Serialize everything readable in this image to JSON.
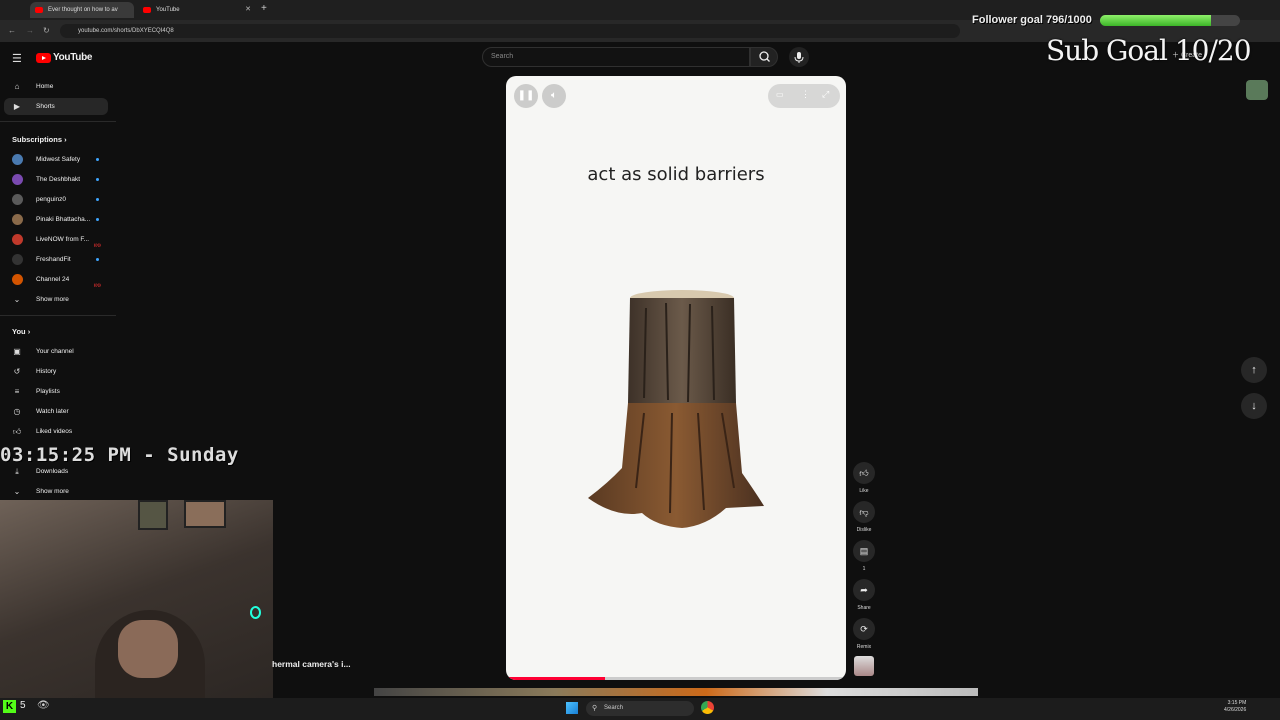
{
  "browser": {
    "tabs": [
      {
        "title": "Ever thought on how to av",
        "active": true
      },
      {
        "title": "YouTube",
        "active": false
      }
    ],
    "url": "youtube.com/shorts/DbXYECQI4Q8"
  },
  "header": {
    "logo_text": "YouTube",
    "search_placeholder": "Search",
    "create_label": "Create"
  },
  "sidebar": {
    "main": [
      {
        "label": "Home",
        "icon": "home-icon"
      },
      {
        "label": "Shorts",
        "icon": "shorts-icon",
        "active": true
      }
    ],
    "subscriptions_heading": "Subscriptions",
    "subscriptions": [
      {
        "label": "Midwest Safety",
        "badge": "dot",
        "color": "#4a7ab0"
      },
      {
        "label": "The Deshbhakt",
        "badge": "dot",
        "color": "#7a4ab0"
      },
      {
        "label": "penguinz0",
        "badge": "dot",
        "color": "#5a5a5a"
      },
      {
        "label": "Pinaki Bhattacha...",
        "badge": "dot",
        "color": "#8a6a4a"
      },
      {
        "label": "LiveNOW from F...",
        "badge": "live",
        "color": "#c0392b"
      },
      {
        "label": "FreshandFit",
        "badge": "dot",
        "color": "#333333"
      },
      {
        "label": "Channel 24",
        "badge": "live",
        "color": "#d35400"
      }
    ],
    "show_more": "Show more",
    "you_heading": "You",
    "you_items": [
      {
        "label": "Your channel",
        "icon": "channel-icon"
      },
      {
        "label": "History",
        "icon": "history-icon"
      },
      {
        "label": "Playlists",
        "icon": "playlists-icon"
      },
      {
        "label": "Watch later",
        "icon": "watch-later-icon"
      },
      {
        "label": "Liked videos",
        "icon": "like-icon"
      },
      {
        "label": "Downloads",
        "icon": "download-icon"
      }
    ],
    "show_more_2": "Show more"
  },
  "short": {
    "caption": "act as solid barriers",
    "progress": 0.29
  },
  "actions": [
    {
      "label": "Like",
      "icon": "like-icon"
    },
    {
      "label": "Dislike",
      "icon": "dislike-icon"
    },
    {
      "label": "1",
      "icon": "comment-icon"
    },
    {
      "label": "Share",
      "icon": "share-icon"
    },
    {
      "label": "Remix",
      "icon": "remix-icon"
    }
  ],
  "overlay": {
    "follower_goal": "Follower goal 796/1000",
    "follower_progress": 0.796,
    "sub_goal": "Sub Goal  10/20",
    "clock": "03:15:25 PM - Sunday",
    "bottom_text": "hermal camera's i...",
    "viewer_count": "5"
  },
  "taskbar": {
    "search": "Search",
    "time": "3:15 PM",
    "date": "4/26/2026"
  },
  "colors": {
    "accent": "#ff0000",
    "progress": "#ff0033",
    "follower_bar": "#3cb528"
  }
}
